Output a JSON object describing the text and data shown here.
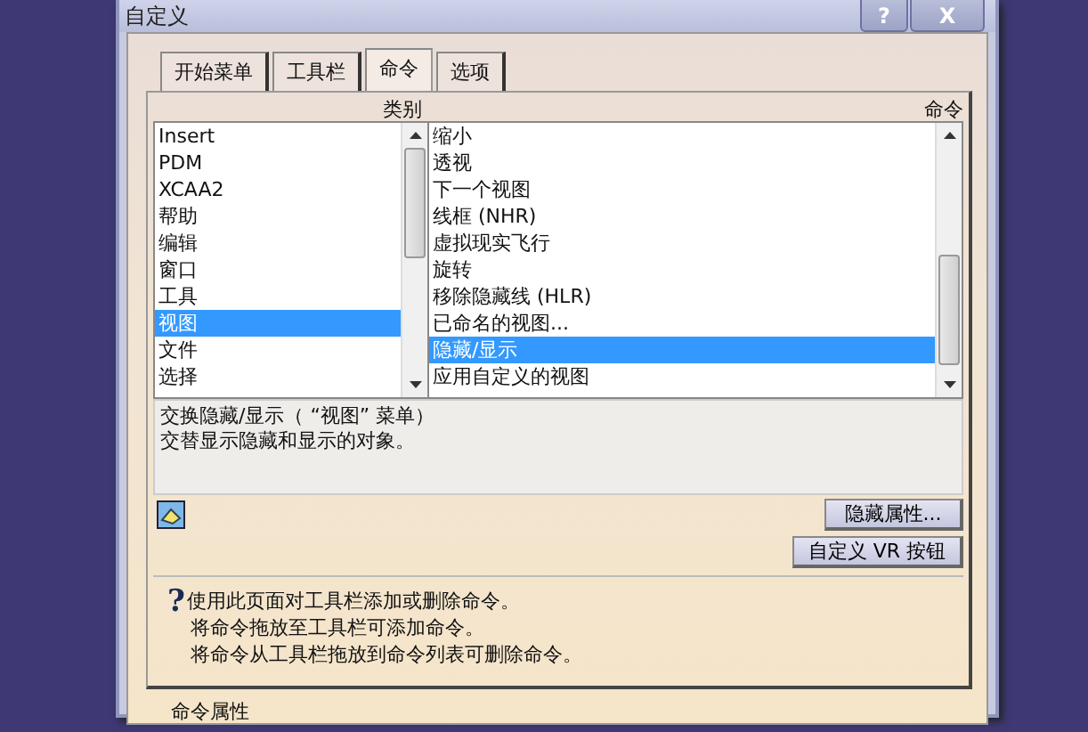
{
  "window": {
    "title": "自定义",
    "buttons": [
      "?",
      "X"
    ]
  },
  "tabs": [
    {
      "label": "开始菜单",
      "selected": false
    },
    {
      "label": "工具栏",
      "selected": false
    },
    {
      "label": "命令",
      "selected": true
    },
    {
      "label": "选项",
      "selected": false
    }
  ],
  "categories": {
    "heading": "类别",
    "items": [
      {
        "label": "Insert",
        "selected": false
      },
      {
        "label": "PDM",
        "selected": false
      },
      {
        "label": "XCAA2",
        "selected": false
      },
      {
        "label": "帮助",
        "selected": false
      },
      {
        "label": "编辑",
        "selected": false
      },
      {
        "label": "窗口",
        "selected": false
      },
      {
        "label": "工具",
        "selected": false
      },
      {
        "label": "视图",
        "selected": true
      },
      {
        "label": "文件",
        "selected": false
      },
      {
        "label": "选择",
        "selected": false
      }
    ]
  },
  "commands": {
    "heading": "命令",
    "items": [
      {
        "label": "缩小",
        "selected": false
      },
      {
        "label": "透视",
        "selected": false
      },
      {
        "label": "下一个视图",
        "selected": false
      },
      {
        "label": "线框 (NHR)",
        "selected": false
      },
      {
        "label": "虚拟现实飞行",
        "selected": false
      },
      {
        "label": "旋转",
        "selected": false
      },
      {
        "label": "移除隐藏线 (HLR)",
        "selected": false
      },
      {
        "label": "已命名的视图...",
        "selected": false
      },
      {
        "label": "隐藏/显示",
        "selected": true
      },
      {
        "label": "应用自定义的视图",
        "selected": false
      }
    ]
  },
  "description": [
    "交换隐藏/显示（ “视图” 菜单）",
    "交替显示隐藏和显示的对象。"
  ],
  "buttons": [
    "隐藏属性...",
    "自定义 VR 按钮"
  ],
  "help": {
    "icon": "?",
    "lines": [
      "使用此页面对工具栏添加或删除命令。",
      "将命令拖放至工具栏可添加命令。",
      "将命令从工具栏拖放到命令列表可删除命令。"
    ]
  },
  "section_label": "命令属性"
}
